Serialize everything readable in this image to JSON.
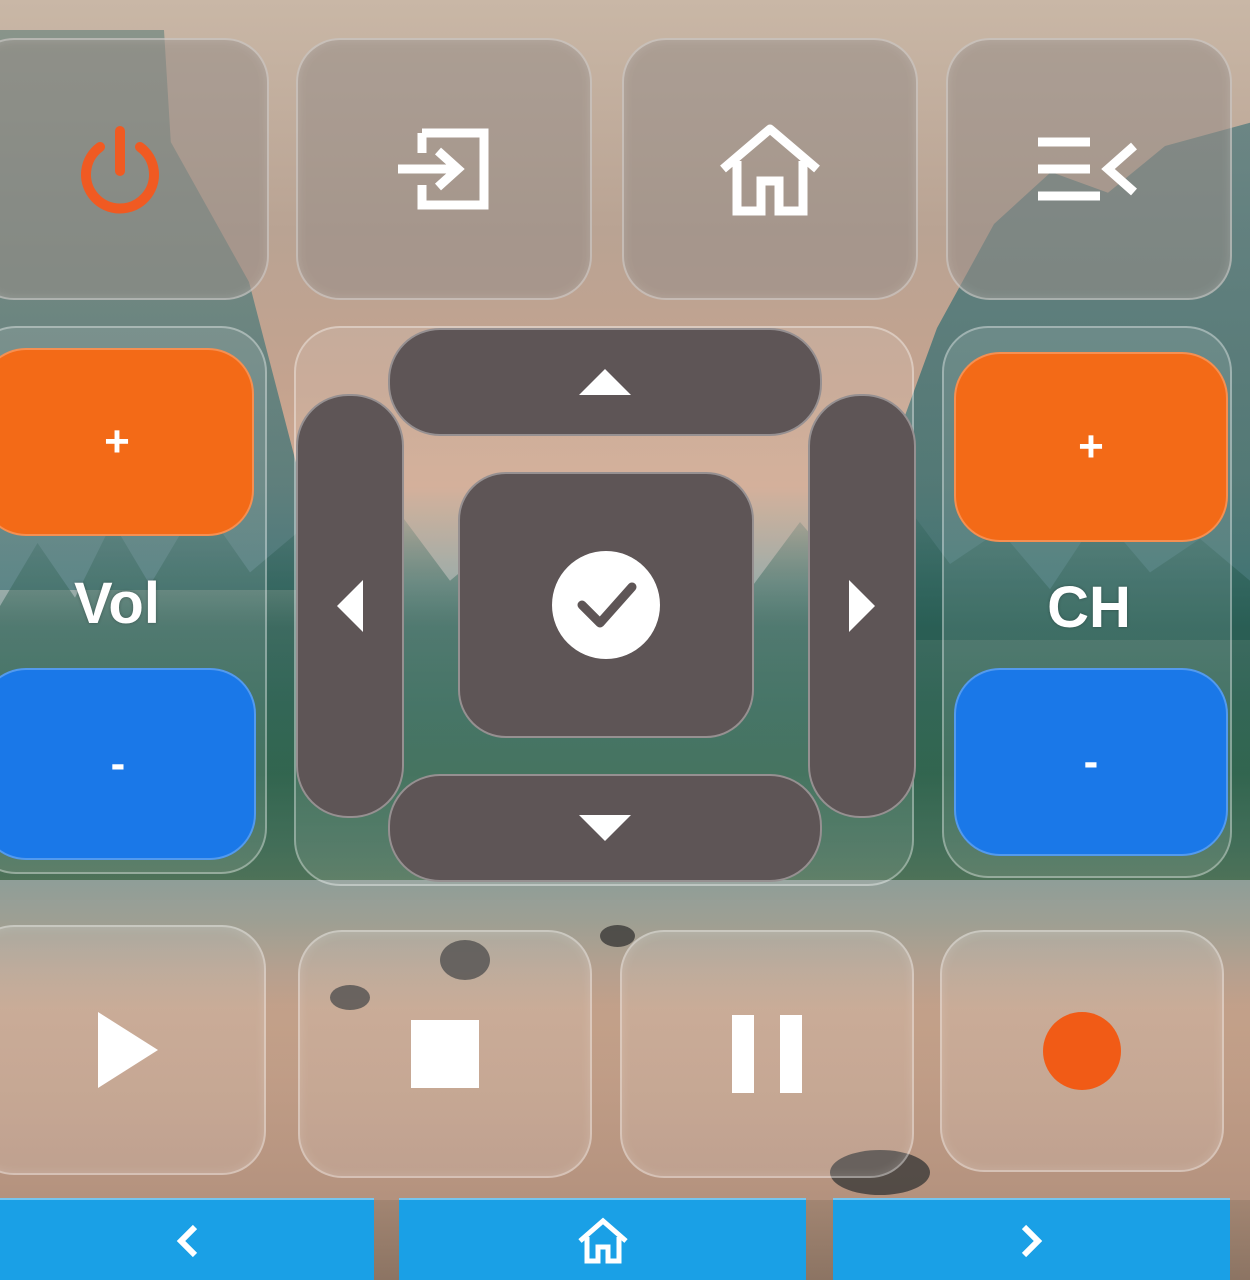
{
  "top_row": {
    "power": "power-icon",
    "input": "input-source-icon",
    "home": "home-icon",
    "menu": "menu-back-icon"
  },
  "volume": {
    "plus_label": "+",
    "label": "Vol",
    "minus_label": "-"
  },
  "channel": {
    "plus_label": "+",
    "label": "CH",
    "minus_label": "-"
  },
  "dpad": {
    "up": "triangle-up-icon",
    "left": "triangle-left-icon",
    "right": "triangle-right-icon",
    "down": "triangle-down-icon",
    "ok": "check-circle-icon"
  },
  "media": {
    "play": "play-icon",
    "stop": "stop-icon",
    "pause": "pause-icon",
    "record": "record-icon"
  },
  "navbar": {
    "back": "chevron-left-icon",
    "home": "home-icon",
    "forward": "chevron-right-icon"
  },
  "colors": {
    "power": "#f05a22",
    "orange": "#f36a17",
    "blue": "#1a78e8",
    "dpad": "#5e5556",
    "navbar": "#1aa0e6",
    "record": "#f15b16"
  }
}
